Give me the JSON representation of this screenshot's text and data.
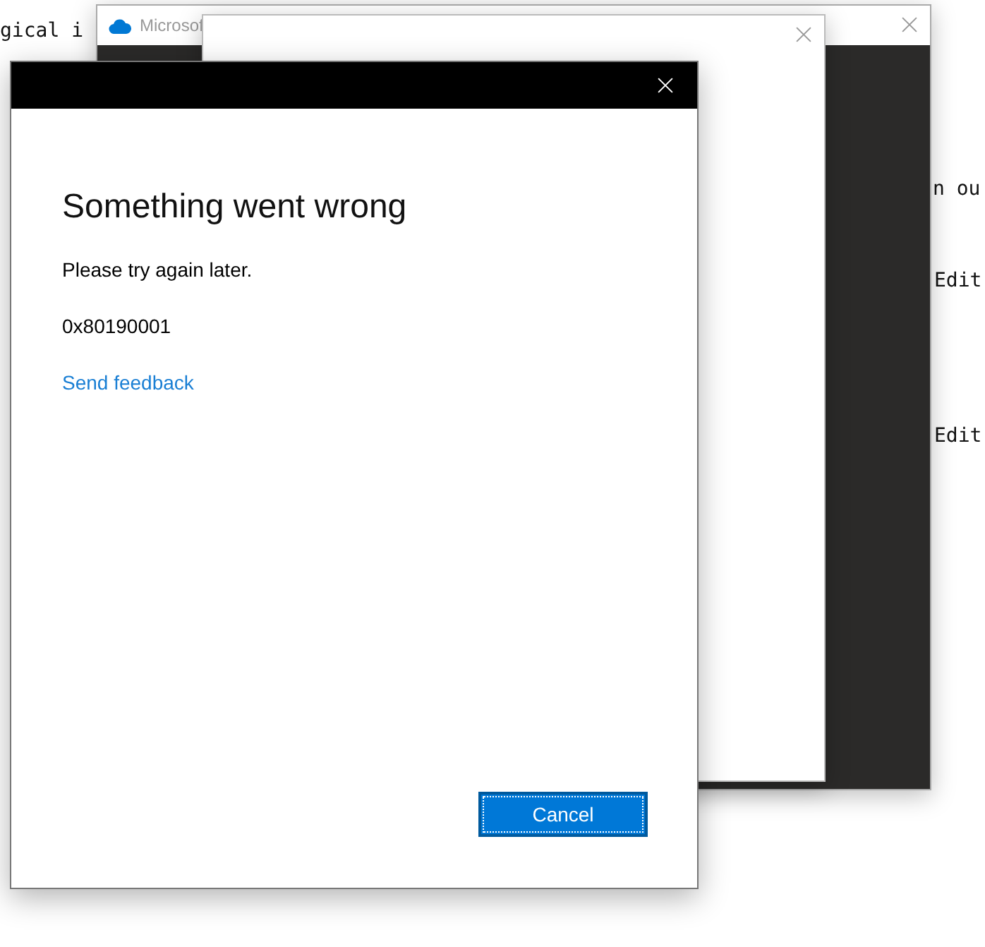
{
  "background_text": [
    {
      "text": "gical i"
    },
    {
      "text": "n ou"
    },
    {
      "text": "Edit"
    },
    {
      "text": "Edit"
    }
  ],
  "back_window": {
    "title": "Microsof"
  },
  "dialog": {
    "heading": "Something went wrong",
    "message": "Please try again later.",
    "error_code": "0x80190001",
    "link": "Send feedback",
    "button": {
      "label": "Cancel",
      "focused": true
    }
  }
}
